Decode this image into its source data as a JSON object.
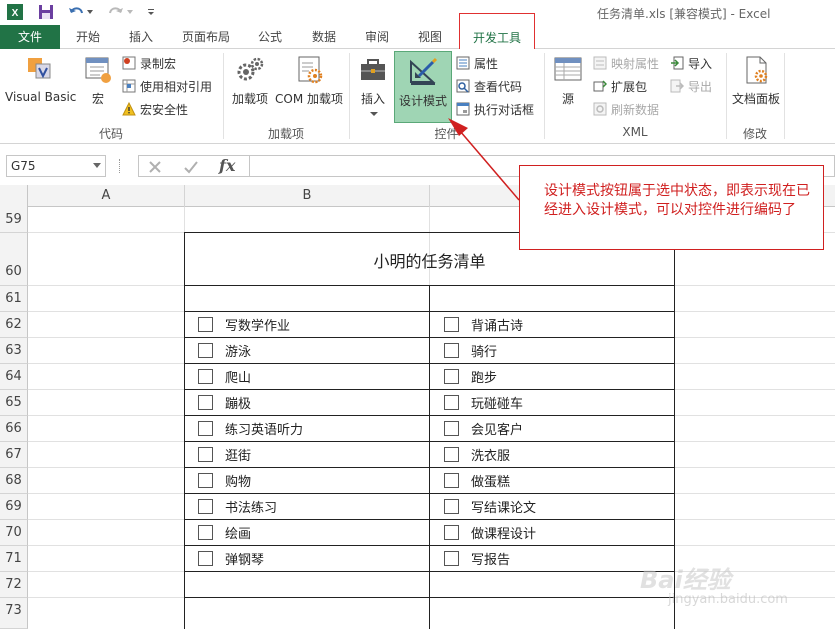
{
  "titlebar": {
    "title": "任务清单.xls  [兼容模式] - Excel",
    "quick_access": [
      "excel-logo-icon",
      "save-icon",
      "undo-icon",
      "redo-icon",
      "customize-qat-icon"
    ]
  },
  "tabs": [
    {
      "label": "文件"
    },
    {
      "label": "开始"
    },
    {
      "label": "插入"
    },
    {
      "label": "页面布局"
    },
    {
      "label": "公式"
    },
    {
      "label": "数据"
    },
    {
      "label": "审阅"
    },
    {
      "label": "视图"
    },
    {
      "label": "开发工具"
    }
  ],
  "ribbon": {
    "code": {
      "group_label": "代码",
      "visual_basic": "Visual Basic",
      "macros": "宏",
      "record_macro": "录制宏",
      "relative_ref": "使用相对引用",
      "macro_security": "宏安全性"
    },
    "addins": {
      "group_label": "加载项",
      "addins": "加载项",
      "com_addins": "COM 加载项"
    },
    "controls": {
      "group_label": "控件",
      "insert": "插入",
      "design_mode": "设计模式",
      "properties": "属性",
      "view_code": "查看代码",
      "run_dialog": "执行对话框"
    },
    "xml": {
      "group_label": "XML",
      "source": "源",
      "map_properties": "映射属性",
      "expansion_packs": "扩展包",
      "refresh_data": "刷新数据",
      "import": "导入",
      "export": "导出"
    },
    "modify": {
      "group_label": "修改",
      "document_panel": "文档面板"
    }
  },
  "formula_bar": {
    "name_box": "G75",
    "fx": "fx",
    "formula": ""
  },
  "columns": [
    "A",
    "B"
  ],
  "rows": [
    "59",
    "60",
    "61",
    "62",
    "63",
    "64",
    "65",
    "66",
    "67",
    "68",
    "69",
    "70",
    "71",
    "72",
    "73"
  ],
  "sheet": {
    "title": "小明的任务清单",
    "left_tasks": [
      "写数学作业",
      "游泳",
      "爬山",
      "蹦极",
      "练习英语听力",
      "逛街",
      "购物",
      "书法练习",
      "绘画",
      "弹钢琴"
    ],
    "right_tasks": [
      "背诵古诗",
      "骑行",
      "跑步",
      "玩碰碰车",
      "会见客户",
      "洗衣服",
      "做蛋糕",
      "写结课论文",
      "做课程设计",
      "写报告"
    ]
  },
  "annotation": {
    "text": "设计模式按钮属于选中状态，即表示现在已经进入设计模式，可以对控件进行编码了"
  },
  "watermark": {
    "text": "Bai经验",
    "sub": "jingyan.baidu.com"
  },
  "colors": {
    "excel_green": "#217346",
    "highlight_red": "#d02020",
    "design_mode_active": "#9fd5b4"
  }
}
